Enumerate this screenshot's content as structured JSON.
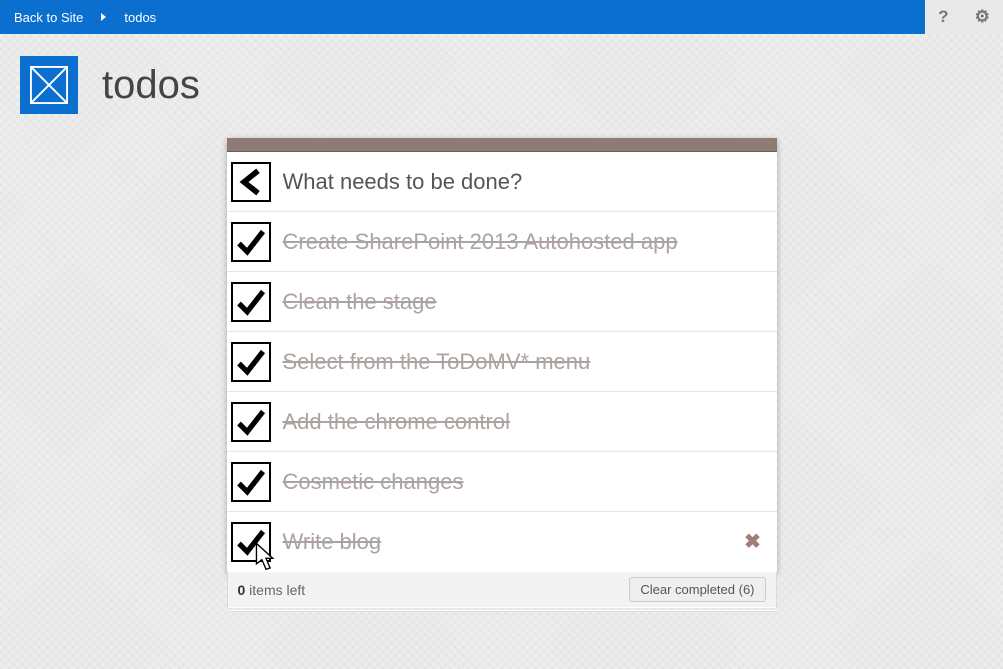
{
  "topbar": {
    "back_label": "Back to Site",
    "breadcrumb": "todos",
    "help_glyph": "?",
    "settings_glyph": "⚙"
  },
  "header": {
    "title": "todos"
  },
  "todo": {
    "new_placeholder": "What needs to be done?",
    "items": [
      {
        "label": "Create SharePoint 2013 Autohosted app",
        "done": true,
        "hover": false
      },
      {
        "label": "Clean the stage",
        "done": true,
        "hover": false
      },
      {
        "label": "Select from the ToDoMV* menu",
        "done": true,
        "hover": false
      },
      {
        "label": "Add the chrome control",
        "done": true,
        "hover": false
      },
      {
        "label": "Cosmetic changes",
        "done": true,
        "hover": false
      },
      {
        "label": "Write blog",
        "done": true,
        "hover": true
      }
    ]
  },
  "footer": {
    "count_number": "0",
    "count_text": " items left",
    "clear_label": "Clear completed (6)"
  },
  "icons": {
    "destroy_glyph": "✖"
  }
}
